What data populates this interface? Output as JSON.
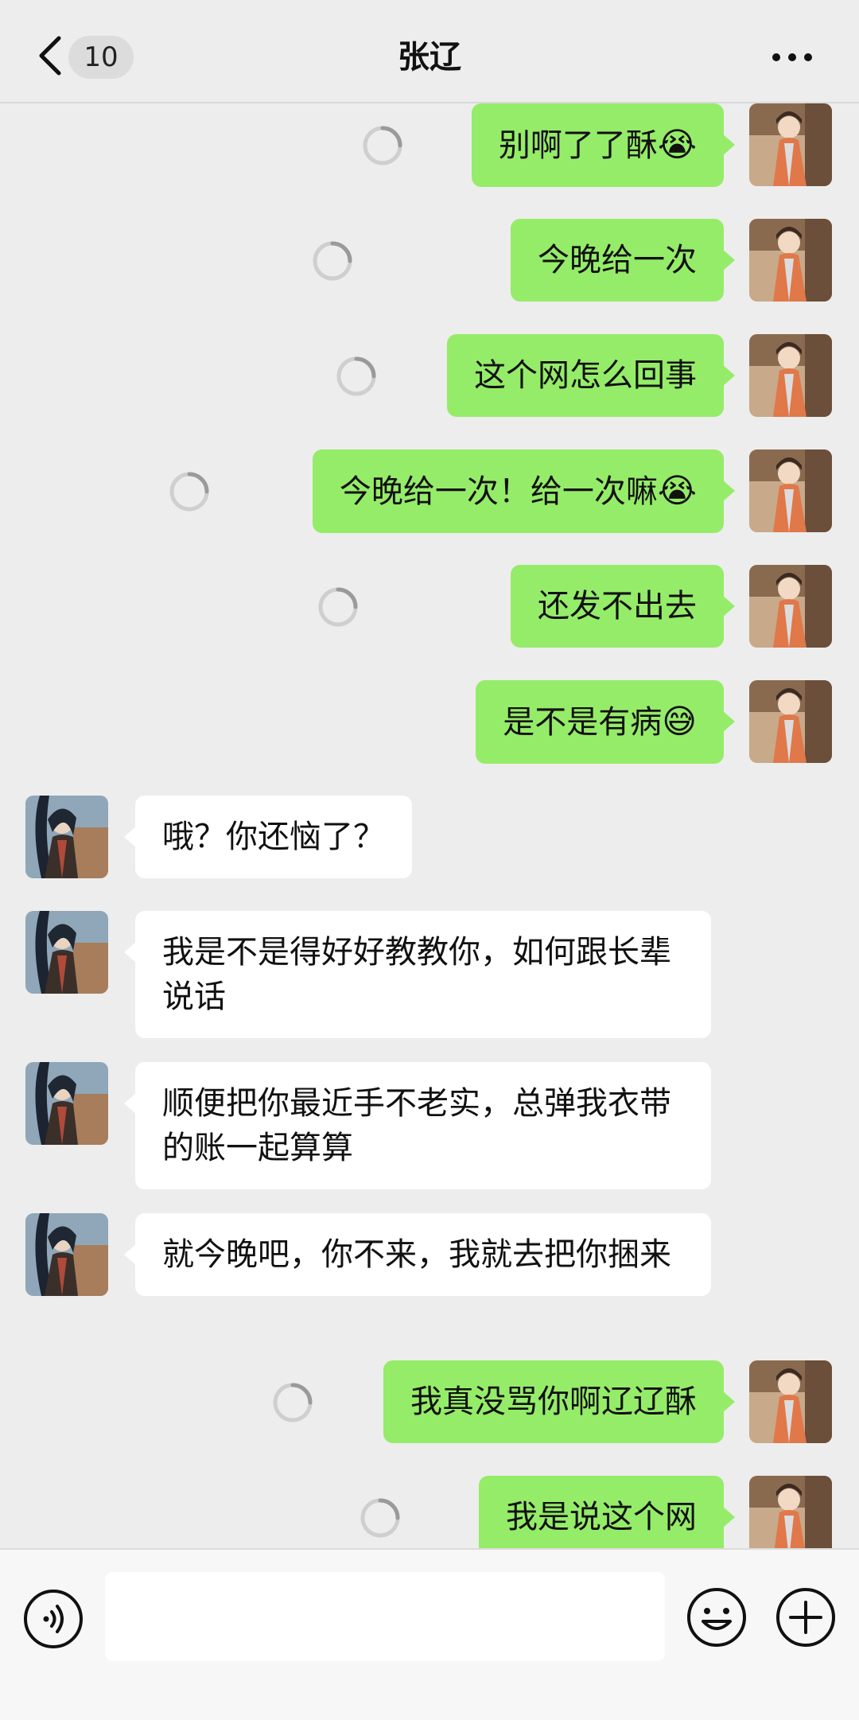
{
  "header": {
    "unread_count": "10",
    "title": "张辽",
    "icons": {
      "back": "chevron-left-icon",
      "more": "more-dots-icon"
    }
  },
  "messages": [
    {
      "dir": "out",
      "text": "别啊了了酥",
      "emoji": "😭",
      "status": "sending"
    },
    {
      "dir": "out",
      "text": "今晚给一次",
      "emoji": "",
      "status": "sending"
    },
    {
      "dir": "out",
      "text": "这个网怎么回事",
      "emoji": "",
      "status": "sending"
    },
    {
      "dir": "out",
      "text": "今晚给一次！给一次嘛",
      "emoji": "😭",
      "status": "sending"
    },
    {
      "dir": "out",
      "text": "还发不出去",
      "emoji": "",
      "status": "sending"
    },
    {
      "dir": "out",
      "text": "是不是有病",
      "emoji": "😅",
      "status": "sent"
    },
    {
      "dir": "in",
      "text": "哦？你还恼了？",
      "emoji": ""
    },
    {
      "dir": "in",
      "text": "我是不是得好好教教你，如何跟长辈说话",
      "emoji": ""
    },
    {
      "dir": "in",
      "text": "顺便把你最近手不老实，总弹我衣带的账一起算算",
      "emoji": ""
    },
    {
      "dir": "in",
      "text": "就今晚吧，你不来，我就去把你捆来",
      "emoji": ""
    },
    {
      "dir": "out",
      "text": "我真没骂你啊辽辽酥",
      "emoji": "",
      "status": "sending"
    },
    {
      "dir": "out",
      "text": "我是说这个网",
      "emoji": "",
      "status": "sending"
    }
  ],
  "input_bar": {
    "input_value": "",
    "icons": {
      "voice": "voice-icon",
      "emoji": "smiley-icon",
      "plus": "plus-icon"
    }
  },
  "colors": {
    "background": "#ededed",
    "outgoing_bubble": "#95ec69",
    "incoming_bubble": "#ffffff"
  }
}
